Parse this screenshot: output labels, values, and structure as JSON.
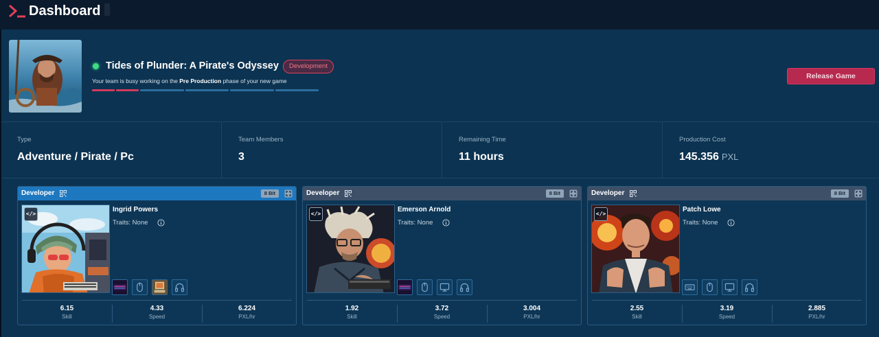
{
  "app": {
    "title": "Dashboard"
  },
  "project": {
    "title": "Tides of Plunder: A Pirate's Odyssey",
    "status_badge": "Development",
    "subtitle_pre": "Your team is busy working on the ",
    "subtitle_phase": "Pre Production",
    "subtitle_post": " phase of your new game",
    "progress": {
      "completed_segments": 2,
      "total_segments": 6
    },
    "release_button": "Release Game",
    "colors": {
      "accent": "#b8294f",
      "status_dot": "#3ddc84",
      "progress_done": "#d23a5c",
      "progress_todo": "#2c6e9e"
    }
  },
  "stats": [
    {
      "label": "Type",
      "value": "Adventure / Pirate / Pc",
      "unit": ""
    },
    {
      "label": "Team Members",
      "value": "3",
      "unit": ""
    },
    {
      "label": "Remaining Time",
      "value": "11 hours",
      "unit": ""
    },
    {
      "label": "Production Cost",
      "value": "145.356",
      "unit": "PXL"
    }
  ],
  "developers": [
    {
      "role": "Developer",
      "bit": "8 Bit",
      "name": "Ingrid Powers",
      "traits": "Traits: None",
      "active": true,
      "gear": [
        "keyboard-item-icon",
        "mouse-icon",
        "computer-item-icon",
        "headphones-icon"
      ],
      "metrics": [
        {
          "value": "6.15",
          "label": "Skill"
        },
        {
          "value": "4.33",
          "label": "Speed"
        },
        {
          "value": "6.224",
          "label": "PXL/hr"
        }
      ]
    },
    {
      "role": "Developer",
      "bit": "8 Bit",
      "name": "Emerson Arnold",
      "traits": "Traits: None",
      "active": false,
      "gear": [
        "keyboard-item-icon",
        "mouse-icon",
        "monitor-icon",
        "headphones-icon"
      ],
      "metrics": [
        {
          "value": "1.92",
          "label": "Skill"
        },
        {
          "value": "3.72",
          "label": "Speed"
        },
        {
          "value": "3.004",
          "label": "PXL/hr"
        }
      ]
    },
    {
      "role": "Developer",
      "bit": "8 Bit",
      "name": "Patch Lowe",
      "traits": "Traits: None",
      "active": false,
      "gear": [
        "keyboard-icon",
        "mouse-icon",
        "monitor-icon",
        "headphones-icon"
      ],
      "metrics": [
        {
          "value": "2.55",
          "label": "Skill"
        },
        {
          "value": "3.19",
          "label": "Speed"
        },
        {
          "value": "2.885",
          "label": "PXL/hr"
        }
      ]
    }
  ]
}
